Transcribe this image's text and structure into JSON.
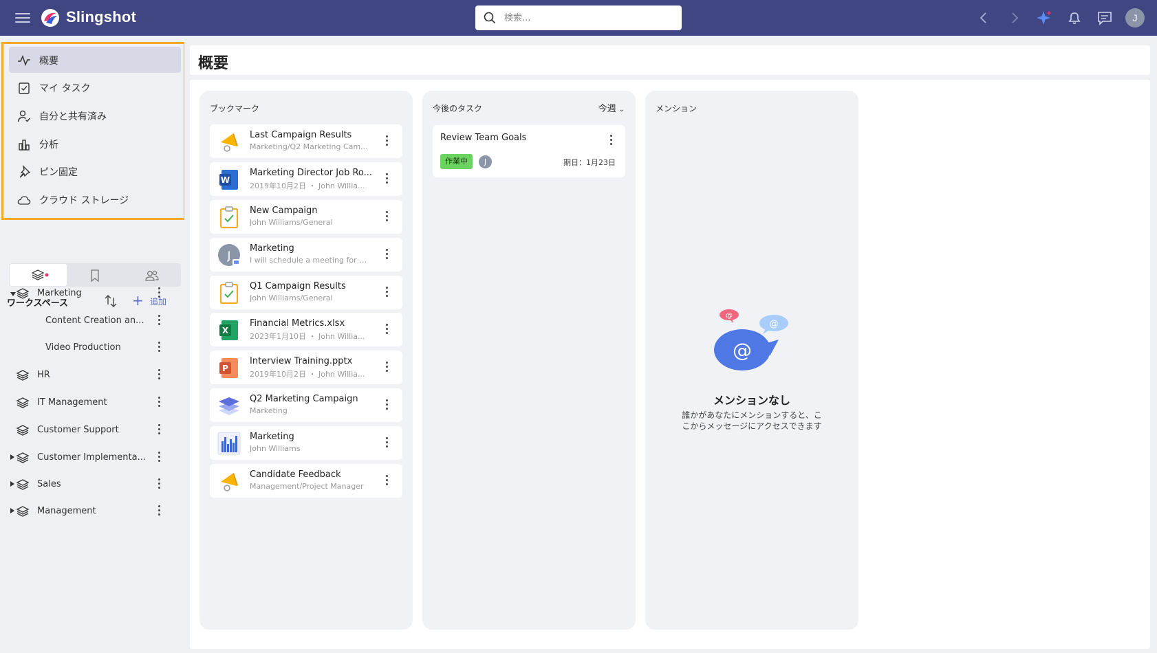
{
  "header": {
    "app_title": "Slingshot",
    "search_placeholder": "検索..."
  },
  "user": {
    "initial": "J"
  },
  "nav": {
    "items": [
      {
        "label": "概要",
        "icon": "activity-icon",
        "active": true
      },
      {
        "label": "マイ タスク",
        "icon": "task-check-icon"
      },
      {
        "label": "自分と共有済み",
        "icon": "user-check-icon"
      },
      {
        "label": "分析",
        "icon": "bar-chart-icon"
      },
      {
        "label": "ピン固定",
        "icon": "pin-icon"
      },
      {
        "label": "クラウド ストレージ",
        "icon": "cloud-icon"
      }
    ]
  },
  "workspaces": {
    "title": "ワークスペース",
    "add_label": "追加",
    "items": [
      {
        "label": "Marketing",
        "expanded": true
      },
      {
        "label": "Content Creation an...",
        "child": true
      },
      {
        "label": "Video Production",
        "child": true
      },
      {
        "label": "HR"
      },
      {
        "label": "IT Management"
      },
      {
        "label": "Customer Support"
      },
      {
        "label": "Customer Implementa...",
        "collapsed": true
      },
      {
        "label": "Sales",
        "collapsed": true
      },
      {
        "label": "Management",
        "collapsed": true
      }
    ]
  },
  "page": {
    "title": "概要"
  },
  "bookmarks": {
    "title": "ブックマーク",
    "items": [
      {
        "name": "Last Campaign Results",
        "sub": "Marketing/Q2 Marketing Cam...",
        "icon": "megaphone-icon"
      },
      {
        "name": "Marketing Director Job Ro...",
        "sub": "2019年10月2日 ・ John Willia...",
        "icon": "word-file-icon"
      },
      {
        "name": "New Campaign",
        "sub": "John Williams/General",
        "icon": "clipboard-task-icon"
      },
      {
        "name": "Marketing",
        "sub": "I will schedule a meeting for to...",
        "icon": "user-chat-icon"
      },
      {
        "name": "Q1 Campaign Results",
        "sub": "John Williams/General",
        "icon": "clipboard-task-icon"
      },
      {
        "name": "Financial Metrics.xlsx",
        "sub": "2023年1月10日 ・ John Willia...",
        "icon": "excel-file-icon"
      },
      {
        "name": "Interview Training.pptx",
        "sub": "2019年10月2日 ・ John Willia...",
        "icon": "powerpoint-file-icon"
      },
      {
        "name": "Q2 Marketing Campaign",
        "sub": "Marketing",
        "icon": "workspace-layers-icon"
      },
      {
        "name": "Marketing",
        "sub": "John Williams",
        "icon": "dashboard-chart-icon"
      },
      {
        "name": "Candidate Feedback",
        "sub": "Management/Project Manager",
        "icon": "megaphone-icon"
      }
    ]
  },
  "tasks": {
    "title": "今後のタスク",
    "filter": "今週",
    "items": [
      {
        "title": "Review Team Goals",
        "status": "作業中",
        "assignee": "J",
        "due": "期日：1月23日"
      }
    ]
  },
  "mentions": {
    "title": "メンション",
    "empty_title": "メンションなし",
    "empty_desc": "誰かがあなたにメンションすると、ここからメッセージにアクセスできます"
  },
  "colors": {
    "topbar": "#3f4682",
    "accent": "#5c6bc0",
    "highlight_border": "#f4a927",
    "status_green": "#6bd35f"
  }
}
